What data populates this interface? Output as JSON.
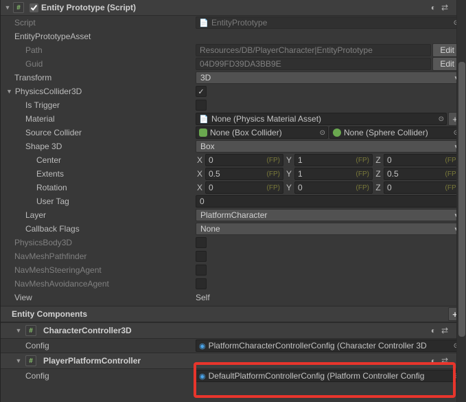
{
  "header": {
    "title": "Entity Prototype (Script)"
  },
  "script": {
    "label": "Script",
    "value": "EntityPrototype"
  },
  "asset": {
    "label": "EntityPrototypeAsset",
    "path_label": "Path",
    "path_value": "Resources/DB/PlayerCharacter|EntityPrototype",
    "guid_label": "Guid",
    "guid_value": "04D99FD39DA3BB9E",
    "edit": "Edit"
  },
  "transform": {
    "label": "Transform",
    "value": "3D"
  },
  "physicsCollider3D": {
    "label": "PhysicsCollider3D",
    "is_trigger_label": "Is Trigger",
    "material_label": "Material",
    "material_value": "None (Physics Material Asset)",
    "source_collider_label": "Source Collider",
    "box_collider": "None (Box Collider)",
    "sphere_collider": "None (Sphere Collider)",
    "shape_label": "Shape 3D",
    "shape_value": "Box",
    "center_label": "Center",
    "center": {
      "x": "0",
      "y": "1",
      "z": "0"
    },
    "extents_label": "Extents",
    "extents": {
      "x": "0.5",
      "y": "1",
      "z": "0.5"
    },
    "rotation_label": "Rotation",
    "rotation": {
      "x": "0",
      "y": "0",
      "z": "0"
    },
    "user_tag_label": "User Tag",
    "user_tag": "0",
    "layer_label": "Layer",
    "layer_value": "PlatformCharacter",
    "callback_label": "Callback Flags",
    "callback_value": "None",
    "fp": "(FP)"
  },
  "toggles": {
    "physicsBody3D": "PhysicsBody3D",
    "navMeshPathfinder": "NavMeshPathfinder",
    "navMeshSteeringAgent": "NavMeshSteeringAgent",
    "navMeshAvoidanceAgent": "NavMeshAvoidanceAgent"
  },
  "view": {
    "label": "View",
    "value": "Self"
  },
  "entityComponents": {
    "label": "Entity Components"
  },
  "cc3d": {
    "title": "CharacterController3D",
    "config_label": "Config",
    "config_value": "PlatformCharacterControllerConfig (Character Controller 3D"
  },
  "ppc": {
    "title": "PlayerPlatformController",
    "config_label": "Config",
    "config_value": "DefaultPlatformControllerConfig (Platform Controller Config"
  }
}
